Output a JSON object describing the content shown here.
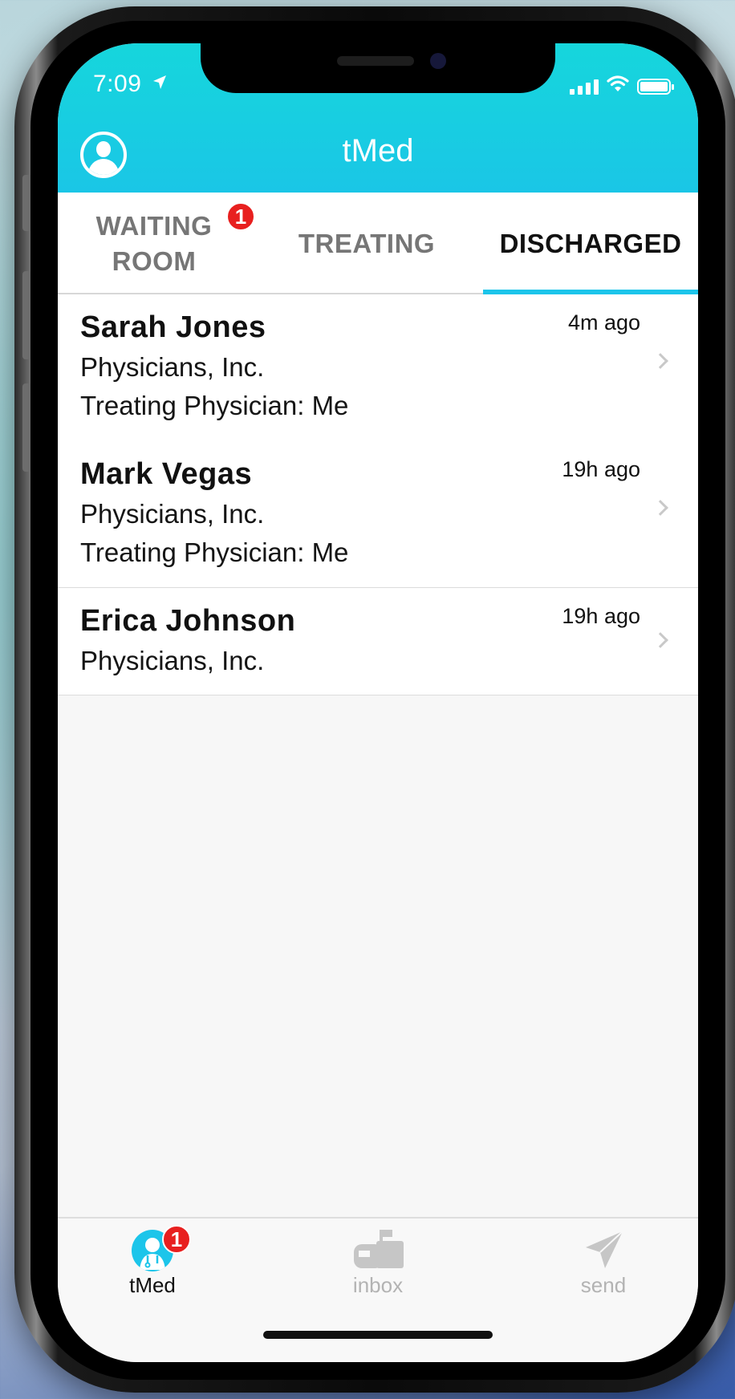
{
  "status_bar": {
    "time": "7:09"
  },
  "header": {
    "title": "tMed"
  },
  "tabs": [
    {
      "label_line1": "WAITING",
      "label_line2": "ROOM",
      "badge": "1",
      "active": false
    },
    {
      "label_line1": "TREATING",
      "active": false
    },
    {
      "label_line1": "DISCHARGED",
      "active": true
    }
  ],
  "patients": [
    {
      "name": "Sarah Jones",
      "org": "Physicians, Inc.",
      "physician": "Treating Physician: Me",
      "time": "4m ago"
    },
    {
      "name": "Mark Vegas",
      "org": "Physicians, Inc.",
      "physician": "Treating Physician: Me",
      "time": "19h ago"
    },
    {
      "name": "Erica Johnson",
      "org": "Physicians, Inc.",
      "time": "19h ago"
    }
  ],
  "tabbar": [
    {
      "label": "tMed",
      "badge": "1",
      "icon": "doctor-icon",
      "active": true
    },
    {
      "label": "inbox",
      "icon": "mailbox-icon",
      "active": false
    },
    {
      "label": "send",
      "icon": "paper-plane-icon",
      "active": false
    }
  ],
  "colors": {
    "accent": "#1cc5ea",
    "header_top": "#16d6dc",
    "badge": "#e8201f"
  }
}
